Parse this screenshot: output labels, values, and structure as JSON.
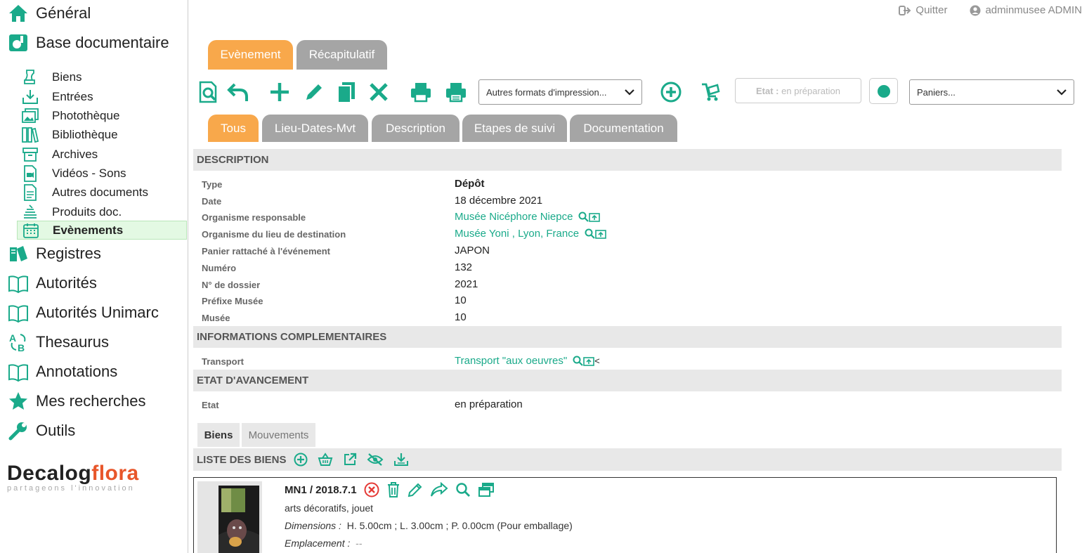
{
  "sidebar": {
    "general": "Général",
    "base_documentaire": "Base documentaire",
    "sub_items": [
      {
        "label": "Biens",
        "icon": "biens-icon"
      },
      {
        "label": "Entrées",
        "icon": "entrees-icon"
      },
      {
        "label": "Photothèque",
        "icon": "phototheque-icon"
      },
      {
        "label": "Bibliothèque",
        "icon": "bibliotheque-icon"
      },
      {
        "label": "Archives",
        "icon": "archives-icon"
      },
      {
        "label": "Vidéos - Sons",
        "icon": "videos-icon"
      },
      {
        "label": "Autres documents",
        "icon": "document-icon"
      },
      {
        "label": "Produits doc.",
        "icon": "produits-icon"
      },
      {
        "label": "Evènements",
        "icon": "calendar-icon",
        "active": true
      }
    ],
    "sections": [
      {
        "label": "Registres",
        "icon": "registres-icon"
      },
      {
        "label": "Autorités",
        "icon": "book-open-icon"
      },
      {
        "label": "Autorités Unimarc",
        "icon": "book-open-icon"
      },
      {
        "label": "Thesaurus",
        "icon": "thesaurus-icon"
      },
      {
        "label": "Annotations",
        "icon": "book-open-icon"
      },
      {
        "label": "Mes recherches",
        "icon": "star-icon"
      },
      {
        "label": "Outils",
        "icon": "wrench-icon"
      }
    ],
    "logo": {
      "decalog": "Decalog",
      "flora": "flora",
      "tagline": "partageons l'innovation"
    }
  },
  "topbar": {
    "quit": "Quitter",
    "user": "adminmusee ADMIN"
  },
  "main_tabs": {
    "evenement": "Evènement",
    "recapitulatif": "Récapitulatif"
  },
  "toolbar": {
    "print_formats": "Autres formats d'impression...",
    "etat_label": "Etat :",
    "etat_value": "en préparation",
    "paniers": "Paniers..."
  },
  "sub_tabs": [
    "Tous",
    "Lieu-Dates-Mvt",
    "Description",
    "Etapes de suivi",
    "Documentation"
  ],
  "description": {
    "title": "DESCRIPTION",
    "fields": [
      {
        "label": "Type",
        "value": "Dépôt"
      },
      {
        "label": "Date",
        "value": "18 décembre 2021"
      },
      {
        "label": "Organisme responsable",
        "value": "Musée Nicéphore Niepce"
      },
      {
        "label": "Organisme du lieu de destination",
        "value": "Musée Yoni , Lyon, France"
      },
      {
        "label": "Panier rattaché à l'événement",
        "value": "JAPON"
      },
      {
        "label": "Numéro",
        "value": "132"
      },
      {
        "label": "N° de dossier",
        "value": "2021"
      },
      {
        "label": "Préfixe Musée",
        "value": "10"
      },
      {
        "label": "Musée",
        "value": "10"
      }
    ]
  },
  "infos": {
    "title": "INFORMATIONS COMPLEMENTAIRES",
    "transport_label": "Transport",
    "transport_value": "Transport \"aux oeuvres\"",
    "suffix": "<"
  },
  "etat": {
    "title": "ETAT D'AVANCEMENT",
    "label": "Etat",
    "value": "en préparation"
  },
  "list_tabs": {
    "biens": "Biens",
    "mouvements": "Mouvements"
  },
  "liste": {
    "title": "LISTE DES BIENS"
  },
  "item": {
    "code": "MN1 / 2018.7.1",
    "category": "arts décoratifs, jouet",
    "dim_label": "Dimensions :",
    "dim_value": "H. 5.00cm ; L. 3.00cm ; P. 0.00cm (Pour emballage)",
    "emp_label": "Emplacement :",
    "emp_value": "--"
  },
  "colors": {
    "accent": "#1aaa8a",
    "tab_active": "#f8a84b",
    "tab_inactive": "#a5a5a5",
    "danger": "#e53935"
  }
}
